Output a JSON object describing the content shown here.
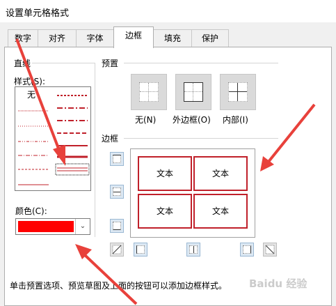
{
  "dialog_title": "设置单元格格式",
  "tabs": [
    {
      "label": "数字",
      "active": false
    },
    {
      "label": "对齐",
      "active": false
    },
    {
      "label": "字体",
      "active": false
    },
    {
      "label": "边框",
      "active": true
    },
    {
      "label": "填充",
      "active": false
    },
    {
      "label": "保护",
      "active": false
    }
  ],
  "line_group": {
    "title": "直线",
    "style_label": "样式(S):",
    "style_none": "无",
    "color_label": "颜色(C):",
    "color_value": "#ff0000"
  },
  "presets": {
    "title": "预置",
    "items": [
      {
        "label": "无(N)"
      },
      {
        "label": "外边框(O)"
      },
      {
        "label": "内部(I)"
      }
    ]
  },
  "border": {
    "title": "边框",
    "cells": [
      "文本",
      "文本",
      "文本",
      "文本"
    ],
    "border_color": "#c0202a"
  },
  "description": "单击预置选项、预览草图及上面的按钮可以添加边框样式。",
  "watermark": "Baidu 经验",
  "annotation_color": "#e8413b"
}
